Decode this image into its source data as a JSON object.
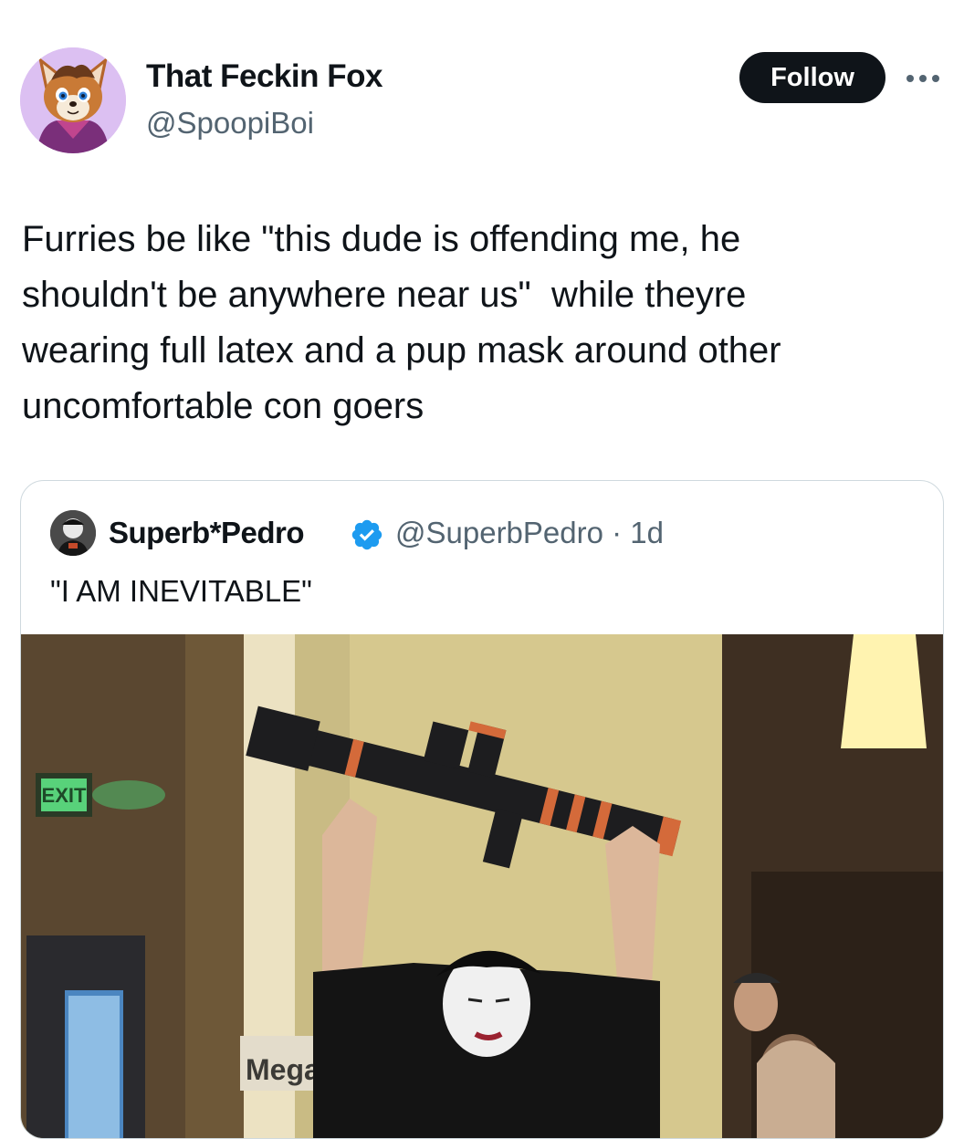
{
  "author": {
    "name": "That Feckin Fox",
    "handle": "@SpoopiBoi"
  },
  "actions": {
    "follow_label": "Follow",
    "more_icon": "more-dots-icon"
  },
  "tweet": {
    "text": "Furries be like \"this dude is offending me, he\nshouldn't be anywhere near us\"  while theyre\nwearing full latex and a pup mask around other\nuncomfortable con goers"
  },
  "quoted": {
    "name": "Superb*Pedro",
    "verified_icon": "verified-badge-icon",
    "meta": "@SuperbPedro · 1d",
    "text": "\"I AM INEVITABLE\"",
    "media": {
      "exit_sign": "EXIT",
      "sign_text": "Mega"
    }
  },
  "colors": {
    "text_primary": "#0f1419",
    "text_secondary": "#536471",
    "follow_bg": "#0f1419",
    "verified": "#1d9bf0",
    "border": "#cfd9de"
  }
}
